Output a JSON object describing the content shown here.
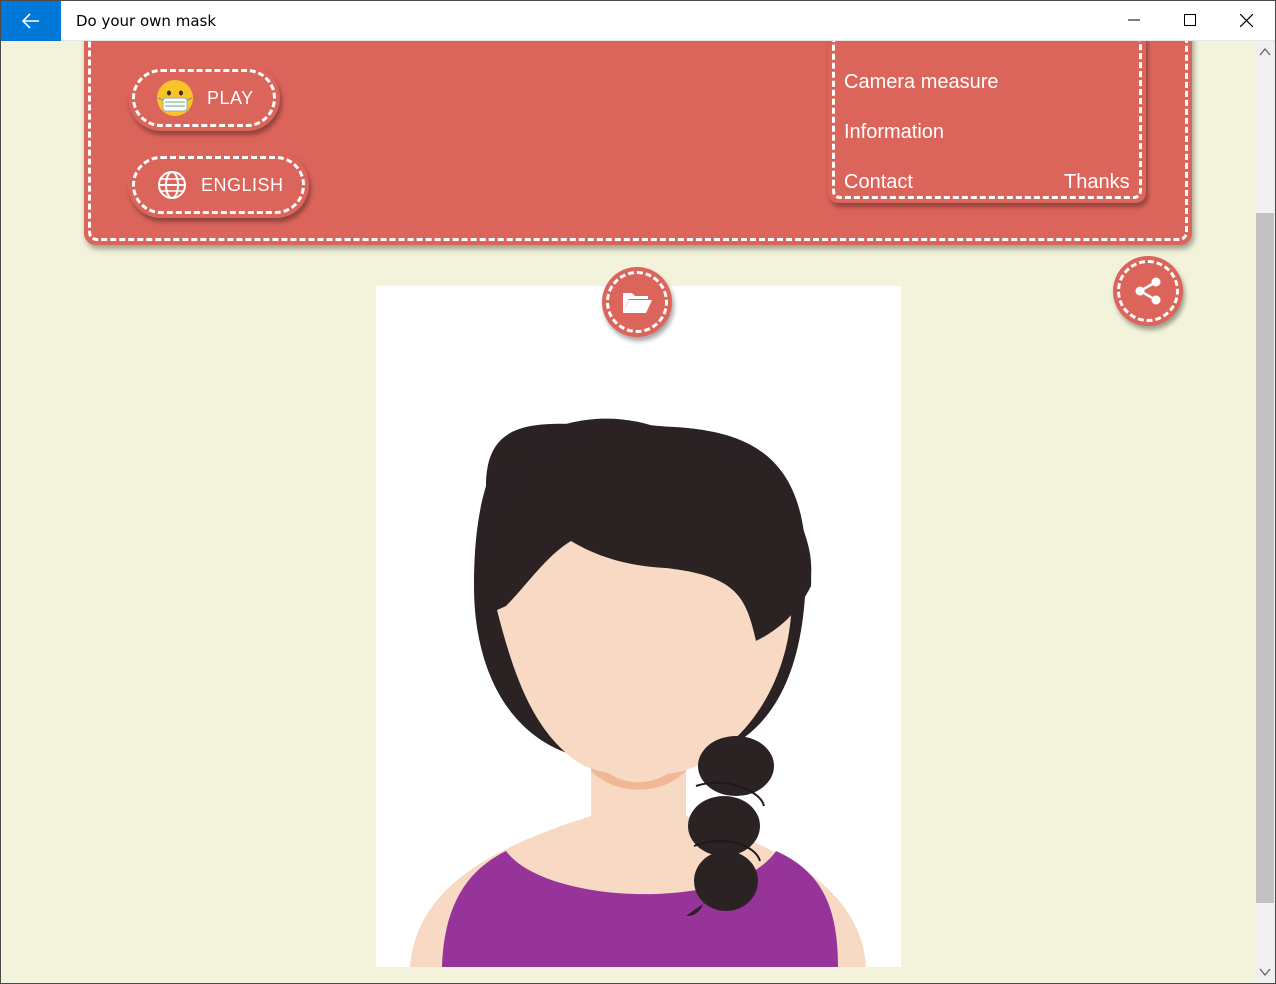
{
  "window": {
    "title": "Do your own mask",
    "back_icon": "arrow-left-icon",
    "accent_color": "#0078d7"
  },
  "header_panel": {
    "color": "#dc655b",
    "play_button": {
      "label": "PLAY",
      "icon": "mask-emoji-icon"
    },
    "language_button": {
      "label": "ENGLISH",
      "icon": "globe-icon"
    },
    "menu": {
      "camera_measure": "Camera measure",
      "information": "Information",
      "contact": "Contact",
      "thanks": "Thanks"
    }
  },
  "actions": {
    "open_folder_icon": "folder-open-icon",
    "share_icon": "share-icon"
  },
  "background_color": "#f3f3dc"
}
